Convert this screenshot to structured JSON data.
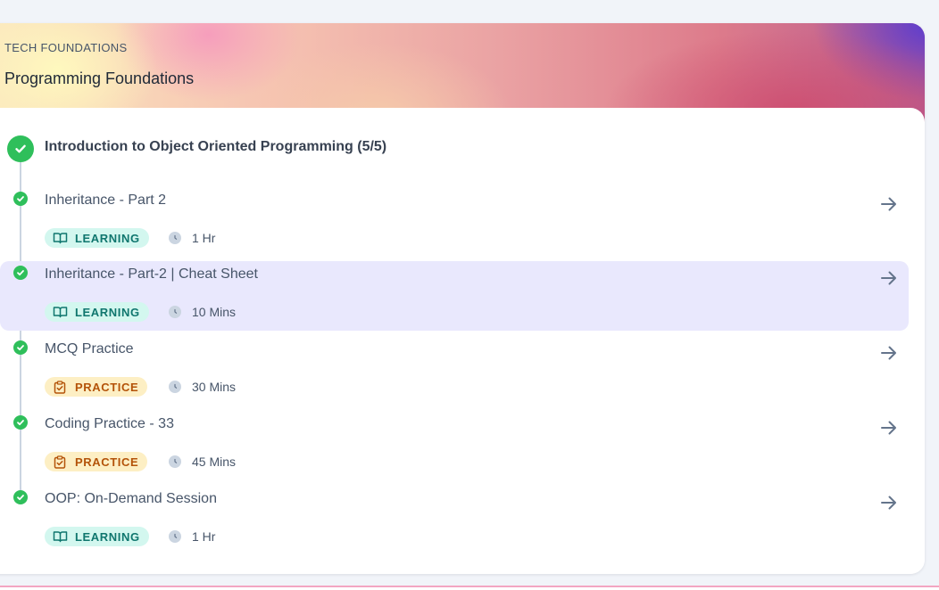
{
  "course": {
    "eyebrow": "TECH FOUNDATIONS",
    "title": "Programming Foundations"
  },
  "section": {
    "title": "Introduction to Object Oriented Programming (5/5)"
  },
  "items": [
    {
      "title": "Inheritance - Part 2",
      "type": "LEARNING",
      "duration": "1 Hr"
    },
    {
      "title": "Inheritance - Part-2 | Cheat Sheet",
      "type": "LEARNING",
      "duration": "10 Mins"
    },
    {
      "title": "MCQ Practice",
      "type": "PRACTICE",
      "duration": "30 Mins"
    },
    {
      "title": "Coding Practice - 33",
      "type": "PRACTICE",
      "duration": "45 Mins"
    },
    {
      "title": "OOP: On-Demand Session",
      "type": "LEARNING",
      "duration": "1 Hr"
    }
  ],
  "icons": {
    "section_status": "check-circle-icon",
    "item_status": "check-circle-icon",
    "learning": "book-open-icon",
    "practice": "clipboard-check-icon",
    "duration": "clock-icon",
    "open": "arrow-right-icon"
  },
  "colors": {
    "complete": "#2fbf5b",
    "learning_bg": "#d3f7ef",
    "learning_text": "#0f766e",
    "practice_bg": "#fdefc4",
    "practice_text": "#b45309",
    "selected_bg": "#e9e8fd"
  }
}
